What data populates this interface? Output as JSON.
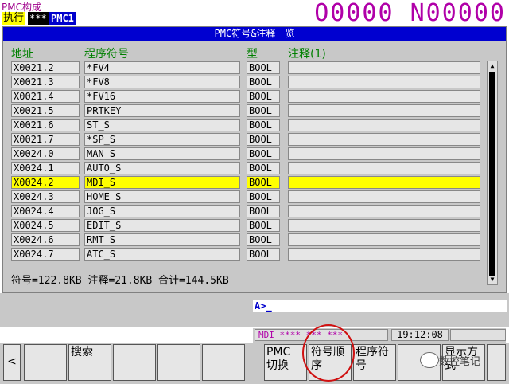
{
  "header": {
    "screen_title": "PMC构成",
    "exec_label": "执行",
    "exec_status": "***",
    "pmc_path": "PMC1",
    "program_number": "O0000 N00000"
  },
  "panel": {
    "title": "PMC符号&注释一览",
    "columns": {
      "address": "地址",
      "symbol": "程序符号",
      "type": "型",
      "comment": "注释(1)"
    },
    "rows": [
      {
        "address": "X0021.2",
        "symbol": "*FV4",
        "type": "BOOL",
        "comment": ""
      },
      {
        "address": "X0021.3",
        "symbol": "*FV8",
        "type": "BOOL",
        "comment": ""
      },
      {
        "address": "X0021.4",
        "symbol": "*FV16",
        "type": "BOOL",
        "comment": ""
      },
      {
        "address": "X0021.5",
        "symbol": "PRTKEY",
        "type": "BOOL",
        "comment": ""
      },
      {
        "address": "X0021.6",
        "symbol": "ST_S",
        "type": "BOOL",
        "comment": ""
      },
      {
        "address": "X0021.7",
        "symbol": "*SP_S",
        "type": "BOOL",
        "comment": ""
      },
      {
        "address": "X0024.0",
        "symbol": "MAN_S",
        "type": "BOOL",
        "comment": ""
      },
      {
        "address": "X0024.1",
        "symbol": "AUTO_S",
        "type": "BOOL",
        "comment": ""
      },
      {
        "address": "X0024.2",
        "symbol": "MDI_S",
        "type": "BOOL",
        "comment": ""
      },
      {
        "address": "X0024.3",
        "symbol": "HOME_S",
        "type": "BOOL",
        "comment": ""
      },
      {
        "address": "X0024.4",
        "symbol": "JOG_S",
        "type": "BOOL",
        "comment": ""
      },
      {
        "address": "X0024.5",
        "symbol": "EDIT_S",
        "type": "BOOL",
        "comment": ""
      },
      {
        "address": "X0024.6",
        "symbol": "RMT_S",
        "type": "BOOL",
        "comment": ""
      },
      {
        "address": "X0024.7",
        "symbol": "ATC_S",
        "type": "BOOL",
        "comment": ""
      }
    ],
    "selected_row_index": 8,
    "sizes_text": "符号=122.8KB 注释=21.8KB 合计=144.5KB"
  },
  "input": {
    "prompt": "A>_"
  },
  "status": {
    "mode": "MDI  **** *** ***",
    "time": "19:12:08"
  },
  "softkeys": {
    "left_arrow": "<",
    "search": "搜索",
    "pmc_switch": "PMC 切换",
    "symbol_order": "符号顺序",
    "program_symbol": "程序符号",
    "display_mode": "显示方式"
  },
  "watermark": {
    "text": "数控笔记"
  },
  "colors": {
    "title_bar": "#0000d0",
    "header_text": "#008000",
    "selected_row": "#ffff00",
    "program_number": "#b000a8",
    "highlight_circle": "#d01010"
  }
}
